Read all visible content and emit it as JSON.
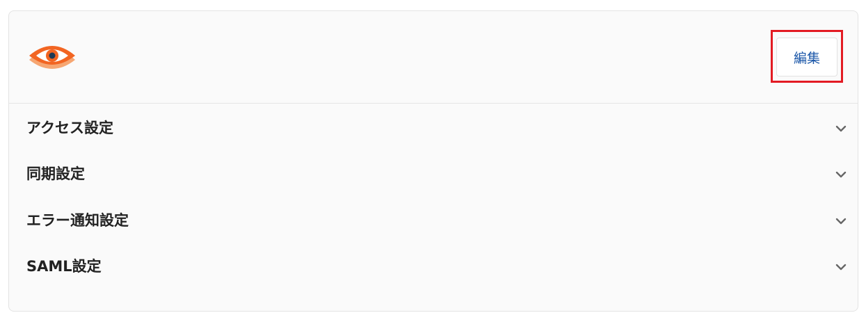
{
  "header": {
    "logo_icon": "orange-eye-logo",
    "edit_label": "編集",
    "highlight_color": "#e31b23"
  },
  "sections": [
    {
      "label": "アクセス設定",
      "icon": "chevron-down-icon"
    },
    {
      "label": "同期設定",
      "icon": "chevron-down-icon"
    },
    {
      "label": "エラー通知設定",
      "icon": "chevron-down-icon"
    },
    {
      "label": "SAML設定",
      "icon": "chevron-down-icon"
    }
  ],
  "colors": {
    "accent_orange": "#f26522",
    "link_blue": "#1a56a8",
    "text_dark": "#222222"
  }
}
